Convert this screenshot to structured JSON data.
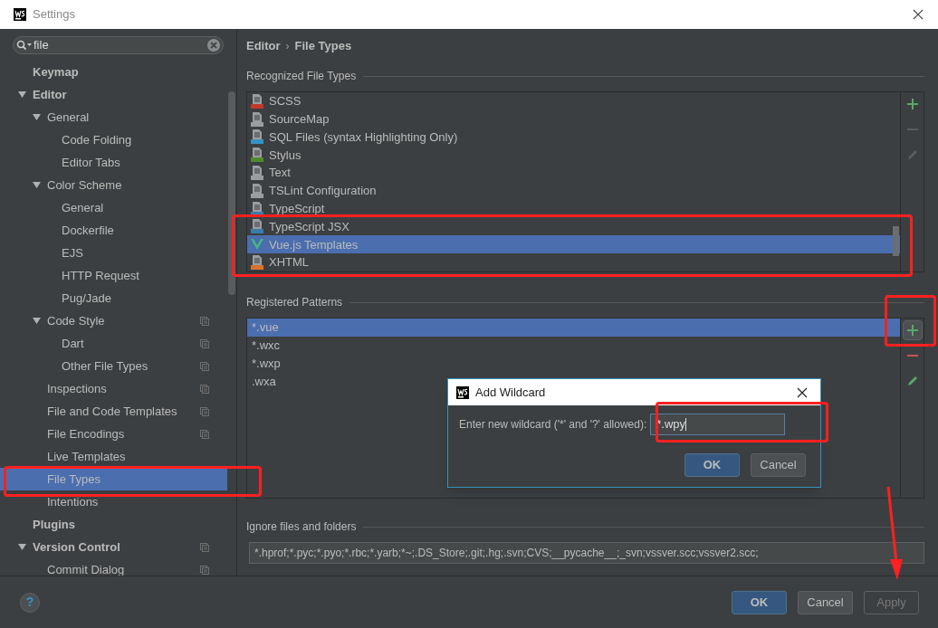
{
  "window": {
    "title": "Settings"
  },
  "sidebar": {
    "search": {
      "value": "file"
    },
    "items": [
      {
        "label": "Keymap",
        "selected": false,
        "shared": false
      },
      {
        "label": "Editor",
        "expanded": true,
        "selected": false,
        "shared": false,
        "children": [
          {
            "label": "General",
            "expanded": true,
            "selected": false,
            "shared": false,
            "children": [
              {
                "label": "Code Folding",
                "selected": false,
                "shared": false
              },
              {
                "label": "Editor Tabs",
                "selected": false,
                "shared": false
              }
            ]
          },
          {
            "label": "Color Scheme",
            "expanded": true,
            "selected": false,
            "shared": false,
            "children": [
              {
                "label": "General",
                "selected": false,
                "shared": false
              },
              {
                "label": "Dockerfile",
                "selected": false,
                "shared": false
              },
              {
                "label": "EJS",
                "selected": false,
                "shared": false
              },
              {
                "label": "HTTP Request",
                "selected": false,
                "shared": false
              },
              {
                "label": "Pug/Jade",
                "selected": false,
                "shared": false
              }
            ]
          },
          {
            "label": "Code Style",
            "expanded": true,
            "selected": false,
            "shared": true,
            "children": [
              {
                "label": "Dart",
                "selected": false,
                "shared": true
              },
              {
                "label": "Other File Types",
                "selected": false,
                "shared": true
              }
            ]
          },
          {
            "label": "Inspections",
            "selected": false,
            "shared": true
          },
          {
            "label": "File and Code Templates",
            "selected": false,
            "shared": true
          },
          {
            "label": "File Encodings",
            "selected": false,
            "shared": true
          },
          {
            "label": "Live Templates",
            "selected": false,
            "shared": false
          },
          {
            "label": "File Types",
            "selected": true,
            "shared": false
          },
          {
            "label": "Intentions",
            "selected": false,
            "shared": false
          }
        ]
      },
      {
        "label": "Plugins",
        "selected": false,
        "shared": false
      },
      {
        "label": "Version Control",
        "expanded": true,
        "selected": false,
        "shared": true,
        "children": [
          {
            "label": "Commit Dialog",
            "selected": false,
            "shared": true
          }
        ]
      }
    ]
  },
  "breadcrumb": {
    "items": [
      "Editor",
      "File Types"
    ],
    "separator": "›"
  },
  "recognized": {
    "title": "Recognized File Types",
    "items": [
      {
        "label": "SCSS",
        "kind": "sass",
        "selected": false
      },
      {
        "label": "SourceMap",
        "kind": "json",
        "selected": false
      },
      {
        "label": "SQL Files (syntax Highlighting Only)",
        "kind": "sql",
        "selected": false
      },
      {
        "label": "Stylus",
        "kind": "stylus",
        "selected": false
      },
      {
        "label": "Text",
        "kind": "text",
        "selected": false
      },
      {
        "label": "TSLint Configuration",
        "kind": "json",
        "selected": false
      },
      {
        "label": "TypeScript",
        "kind": "ts",
        "selected": false
      },
      {
        "label": "TypeScript JSX",
        "kind": "tsx",
        "selected": false
      },
      {
        "label": "Vue.js Templates",
        "kind": "vue",
        "selected": true
      },
      {
        "label": "XHTML",
        "kind": "xhtml",
        "selected": false
      }
    ]
  },
  "patterns": {
    "title": "Registered Patterns",
    "items": [
      {
        "label": "*.vue",
        "selected": true
      },
      {
        "label": "*.wxc",
        "selected": false
      },
      {
        "label": "*.wxp",
        "selected": false
      },
      {
        "label": ".wxa",
        "selected": false
      }
    ]
  },
  "ignore": {
    "title": "Ignore files and folders",
    "value": "*.hprof;*.pyc;*.pyo;*.rbc;*.yarb;*~;.DS_Store;.git;.hg;.svn;CVS;__pycache__;_svn;vssver.scc;vssver2.scc;"
  },
  "dialog": {
    "title": "Add Wildcard",
    "label": "Enter new wildcard ('*' and '?' allowed):",
    "value": "*.wpy",
    "buttons": [
      {
        "label": "OK",
        "default": true
      },
      {
        "label": "Cancel",
        "default": false
      }
    ]
  },
  "help": {
    "label": "?"
  },
  "buttons": [
    {
      "label": "OK",
      "default": true,
      "disabled": false
    },
    {
      "label": "Cancel",
      "default": false,
      "disabled": false
    },
    {
      "label": "Apply",
      "default": false,
      "disabled": true
    }
  ]
}
